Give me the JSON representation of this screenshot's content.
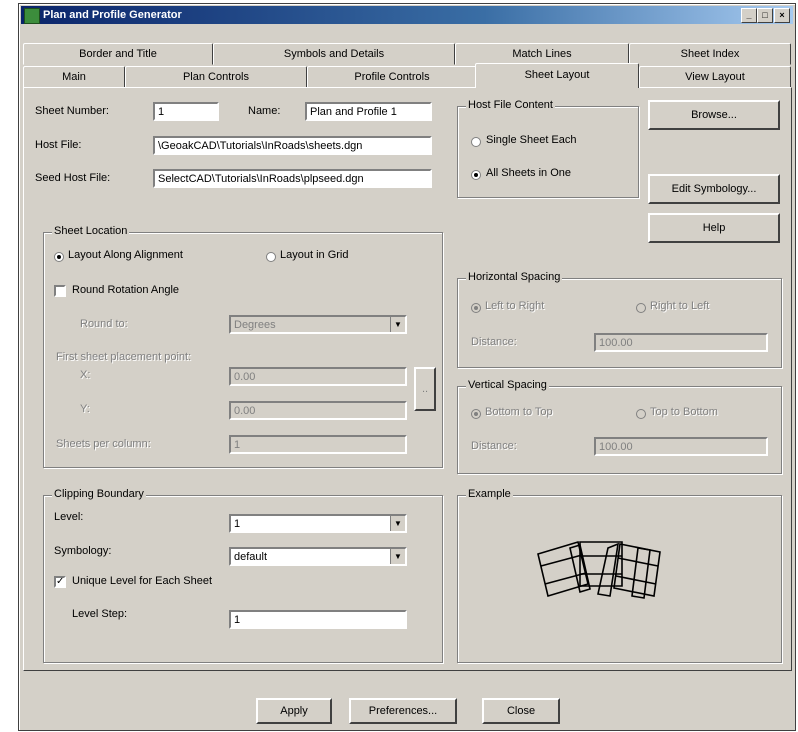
{
  "window": {
    "title": "Plan and Profile Generator",
    "min": "_",
    "max": "□",
    "close": "×"
  },
  "tabs_back": [
    "Border and Title",
    "Symbols and Details",
    "Match Lines",
    "Sheet Index"
  ],
  "tabs_front": [
    "Main",
    "Plan Controls",
    "Profile Controls",
    "Sheet Layout",
    "View Layout"
  ],
  "fields": {
    "sheet_number_label": "Sheet Number:",
    "sheet_number_value": "1",
    "name_label": "Name:",
    "name_value": "Plan and Profile 1",
    "host_file_label": "Host File:",
    "host_file_value": "\\GeoakCAD\\Tutorials\\InRoads\\sheets.dgn",
    "seed_host_label": "Seed Host File:",
    "seed_host_value": "SelectCAD\\Tutorials\\InRoads\\plpseed.dgn"
  },
  "host_file_content": {
    "title": "Host File Content",
    "single": "Single Sheet Each",
    "all": "All Sheets in One"
  },
  "side_buttons": {
    "browse": "Browse...",
    "edit_symbology": "Edit Symbology...",
    "help": "Help"
  },
  "sheet_location": {
    "title": "Sheet Location",
    "along": "Layout Along Alignment",
    "grid": "Layout in Grid",
    "round": "Round Rotation Angle",
    "round_to_label": "Round to:",
    "round_to_value": "Degrees",
    "pt1_label": "First sheet placement point:",
    "x_label": "X:",
    "x_value": "0.00",
    "y_label": "Y:",
    "y_value": "0.00",
    "picker": "..",
    "sheets_per_label": "Sheets per column:",
    "sheets_per_value": "1"
  },
  "horizontal_spacing": {
    "title": "Horizontal Spacing",
    "opt1": "Left to Right",
    "opt2": "Right to Left",
    "dist_label": "Distance:",
    "dist_value": "100.00"
  },
  "vertical_spacing": {
    "title": "Vertical Spacing",
    "opt1": "Bottom to Top",
    "opt2": "Top to Bottom",
    "dist_label": "Distance:",
    "dist_value": "100.00"
  },
  "clipping": {
    "title": "Clipping Boundary",
    "level_label": "Level:",
    "level_value": "1",
    "symbology_label": "Symbology:",
    "symbology_value": "default",
    "unique_label": "Unique Level for Each Sheet",
    "level_step_label": "Level Step:",
    "level_step_value": "1"
  },
  "example": {
    "title": "Example"
  },
  "bottom_buttons": {
    "apply": "Apply",
    "preferences": "Preferences...",
    "close": "Close"
  }
}
